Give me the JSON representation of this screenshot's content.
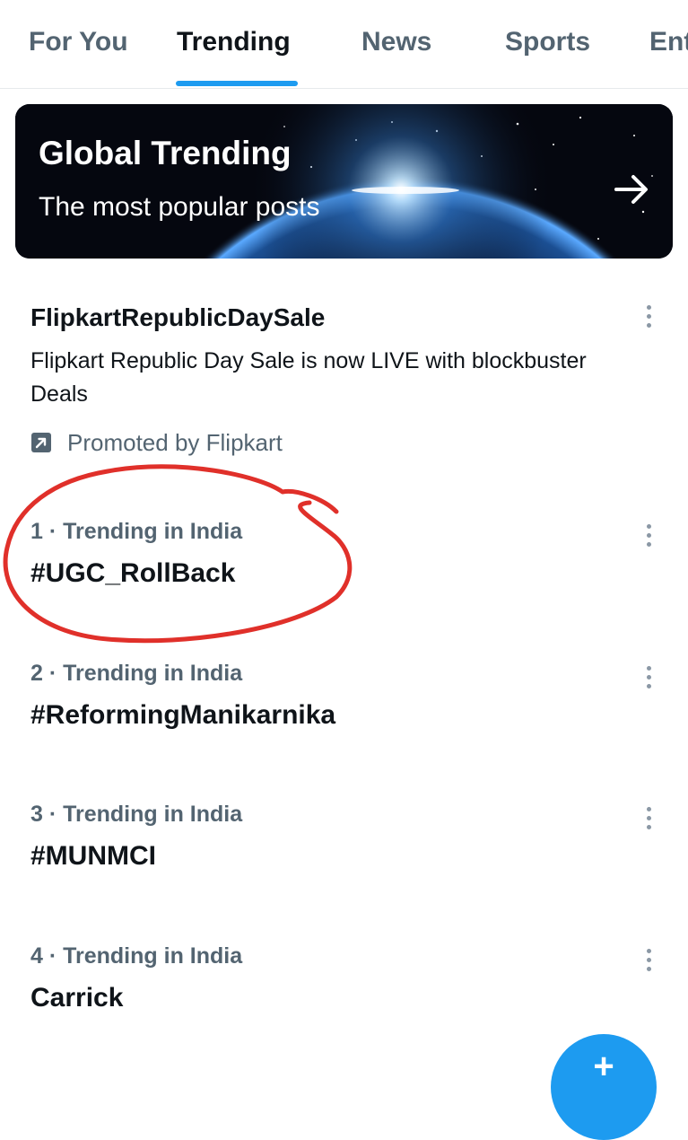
{
  "tabs": [
    "For You",
    "Trending",
    "News",
    "Sports",
    "Ent"
  ],
  "banner": {
    "title": "Global Trending",
    "subtitle": "The most popular posts",
    "arrow_icon": "arrow-right-icon"
  },
  "promoted": {
    "title": "FlipkartRepublicDaySale",
    "description": "Flipkart Republic Day Sale is now LIVE with blockbuster Deals",
    "promoted_by": "Promoted by Flipkart",
    "icon": "promoted-arrow-icon"
  },
  "trends": [
    {
      "meta": "1 · Trending in India",
      "name": "#UGC_RollBack"
    },
    {
      "meta": "2 · Trending in India",
      "name": "#ReformingManikarnika"
    },
    {
      "meta": "3 · Trending in India",
      "name": "#MUNMCI"
    },
    {
      "meta": "4 · Trending in India",
      "name": "Carrick"
    }
  ],
  "fab": {
    "symbol": "+",
    "icon": "compose-plus-icon"
  },
  "colors": {
    "accent": "#1d9bf0",
    "annotation": "#e0302a",
    "secondary_text": "#536471"
  }
}
